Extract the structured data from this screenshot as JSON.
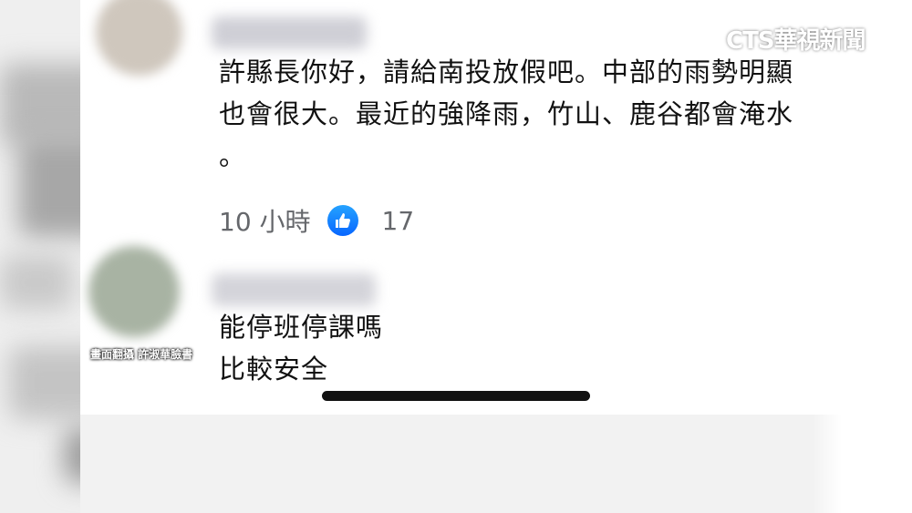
{
  "logo": {
    "text": "CTS華視新聞"
  },
  "screen_credit": "畫面翻攝 許淑華臉書",
  "comments": [
    {
      "lines": [
        "許縣長你好，請給南投放假吧。中部的雨勢明顯",
        "也會很大。最近的強降雨，竹山、鹿谷都會淹水",
        "。"
      ],
      "time": "10 小時",
      "likes": "17"
    },
    {
      "lines": [
        "能停班停課嗎",
        "比較安全"
      ]
    }
  ],
  "colors": {
    "like_blue": "#0866ff",
    "meta_gray": "#65676b"
  }
}
